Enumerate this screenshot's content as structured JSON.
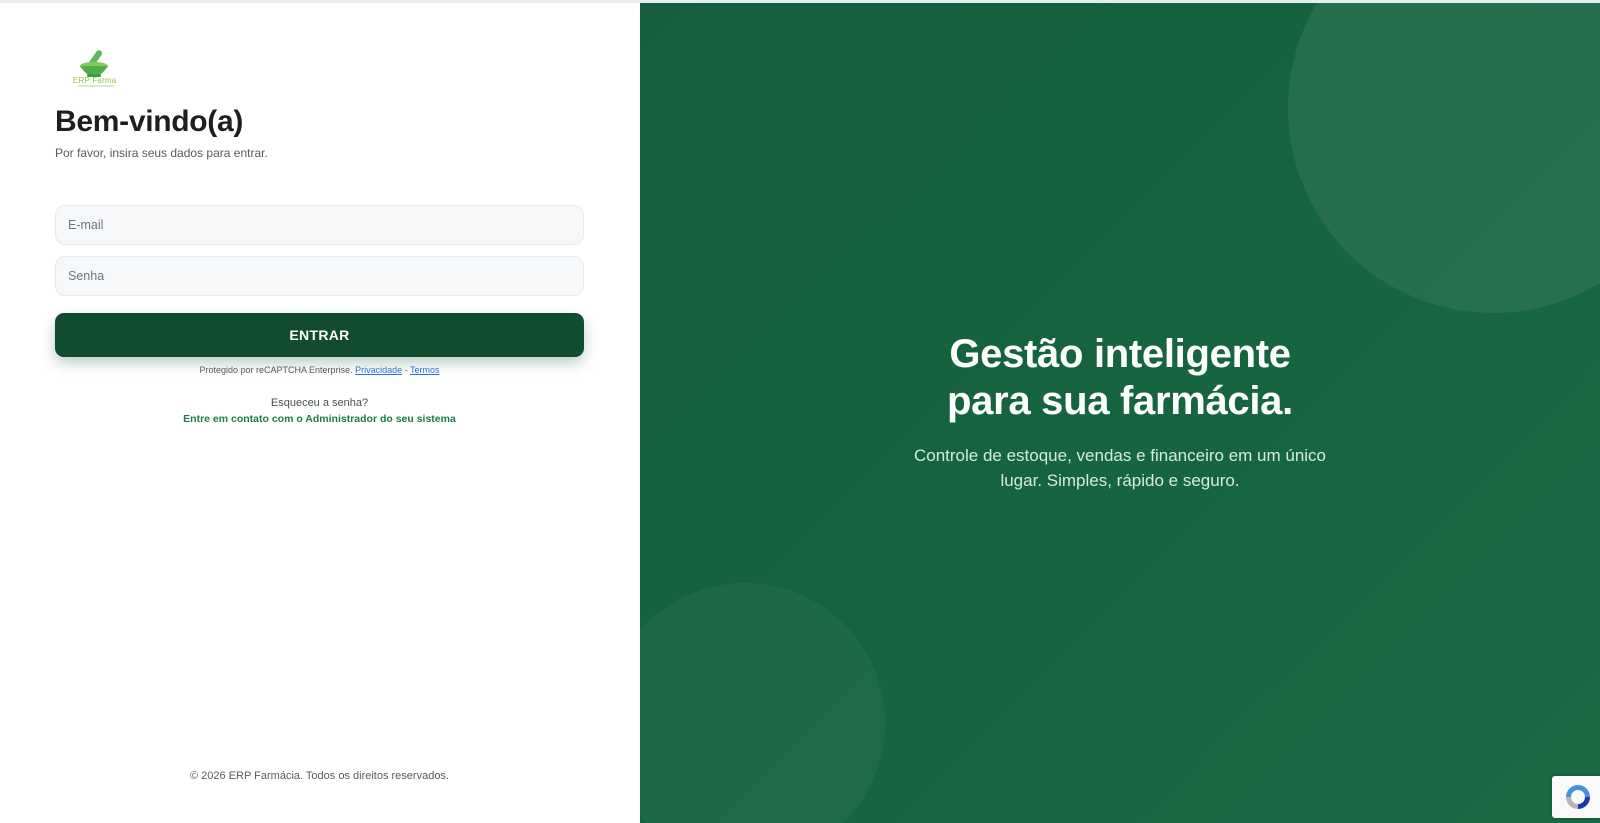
{
  "brand": {
    "logo_icon": "mortar-pestle-icon",
    "logo_text": "ERP Farma"
  },
  "login": {
    "title": "Bem-vindo(a)",
    "subtitle": "Por favor, insira seus dados para entrar.",
    "email_placeholder": "E-mail",
    "password_placeholder": "Senha",
    "submit_label": "ENTRAR",
    "recaptcha_text": "Protegido por reCAPTCHA Enterprise.",
    "privacy_link": "Privacidade",
    "separator": "-",
    "terms_link": "Termos",
    "forgot_text": "Esqueceu a senha?",
    "contact_link": "Entre em contato com o Administrador do seu sistema"
  },
  "footer": {
    "copyright": "© 2026 ERP Farmácia. Todos os direitos reservados."
  },
  "hero": {
    "title_line1": "Gestão inteligente",
    "title_line2": "para sua farmácia.",
    "description": "Controle de estoque, vendas e financeiro em um único lugar. Simples, rápido e seguro."
  },
  "recaptcha_badge": {
    "icon": "recaptcha-icon"
  },
  "colors": {
    "primary_dark": "#114b30",
    "hero_green": "#155f3e",
    "link_green": "#1f7a4a",
    "link_blue": "#2f6ee0",
    "logo_green": "#8dc84a"
  }
}
